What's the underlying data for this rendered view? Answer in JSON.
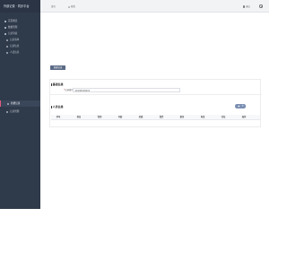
{
  "sidebar": {
    "brand": "外部记录 · 同步平台",
    "items": [
      {
        "label": "首页概览",
        "sub": false
      },
      {
        "label": "数据管理",
        "sub": false
      },
      {
        "label": "记录列表",
        "sub": false
      },
      {
        "label": "记录清单",
        "sub": true
      },
      {
        "label": "记录信息",
        "sub": true
      },
      {
        "label": "人员信息",
        "sub": true
      },
      {
        "label": "新增记录",
        "sub": true,
        "active": true
      },
      {
        "label": "记录管理",
        "sub": true
      }
    ]
  },
  "topbar": {
    "tabs": [
      {
        "label": "首页"
      },
      {
        "label": "新增"
      }
    ],
    "logout_label": "退出"
  },
  "main": {
    "create_button": "新建记录",
    "section_basic": "基础信息",
    "field": {
      "label": "记录编号",
      "value": "20190520001"
    },
    "section_people": "人员信息",
    "table_headers": [
      "序号",
      "姓名",
      "性别",
      "年龄",
      "民族",
      "籍贯",
      "职务",
      "电话",
      "住址",
      "操作"
    ]
  },
  "colors": {
    "sidebar_bg": "#2f3a4a",
    "accent": "#e25a7f",
    "button": "#5b6b86",
    "edit_button": "#7b8fb3"
  }
}
